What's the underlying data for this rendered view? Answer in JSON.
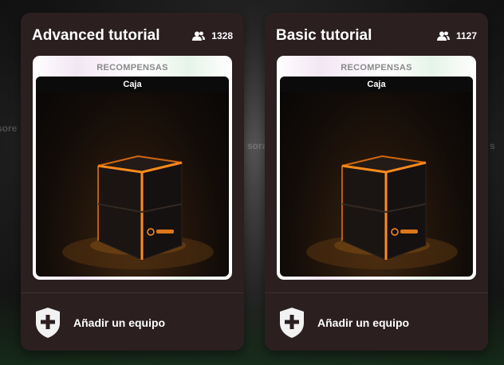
{
  "tutorials": [
    {
      "title": "Advanced tutorial",
      "players": "1328",
      "rewards_label": "RECOMPENSAS",
      "reward_name": "Caja",
      "add_team_label": "Añadir un equipo"
    },
    {
      "title": "Basic tutorial",
      "players": "1127",
      "rewards_label": "RECOMPENSAS",
      "reward_name": "Caja",
      "add_team_label": "Añadir un equipo"
    }
  ],
  "icons": {
    "players": "users-icon",
    "add_team": "shield-plus-icon"
  },
  "colors": {
    "card_bg": "#2b1f20",
    "crate_glow": "#ff8a1c"
  }
}
